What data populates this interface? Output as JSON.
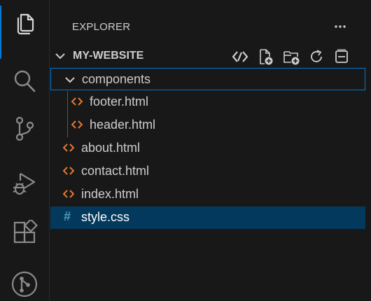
{
  "explorer": {
    "title": "EXPLORER",
    "more_label": "…"
  },
  "workspace": {
    "name": "MY-WEBSITE",
    "actions": [
      "open-editors-icon",
      "new-file-icon",
      "new-folder-icon",
      "refresh-icon",
      "collapse-all-icon"
    ]
  },
  "tree": {
    "folder": {
      "name": "components",
      "expanded": true
    },
    "children": [
      {
        "name": "footer.html",
        "icon": "html-icon"
      },
      {
        "name": "header.html",
        "icon": "html-icon"
      }
    ],
    "files": [
      {
        "name": "about.html",
        "icon": "html-icon"
      },
      {
        "name": "contact.html",
        "icon": "html-icon"
      },
      {
        "name": "index.html",
        "icon": "html-icon"
      },
      {
        "name": "style.css",
        "icon": "css-icon",
        "selected": true
      }
    ]
  },
  "colors": {
    "accent": "#0078d4",
    "selection": "#04395e",
    "html_icon": "#e37933",
    "css_icon": "#519aba",
    "background": "#181818"
  }
}
